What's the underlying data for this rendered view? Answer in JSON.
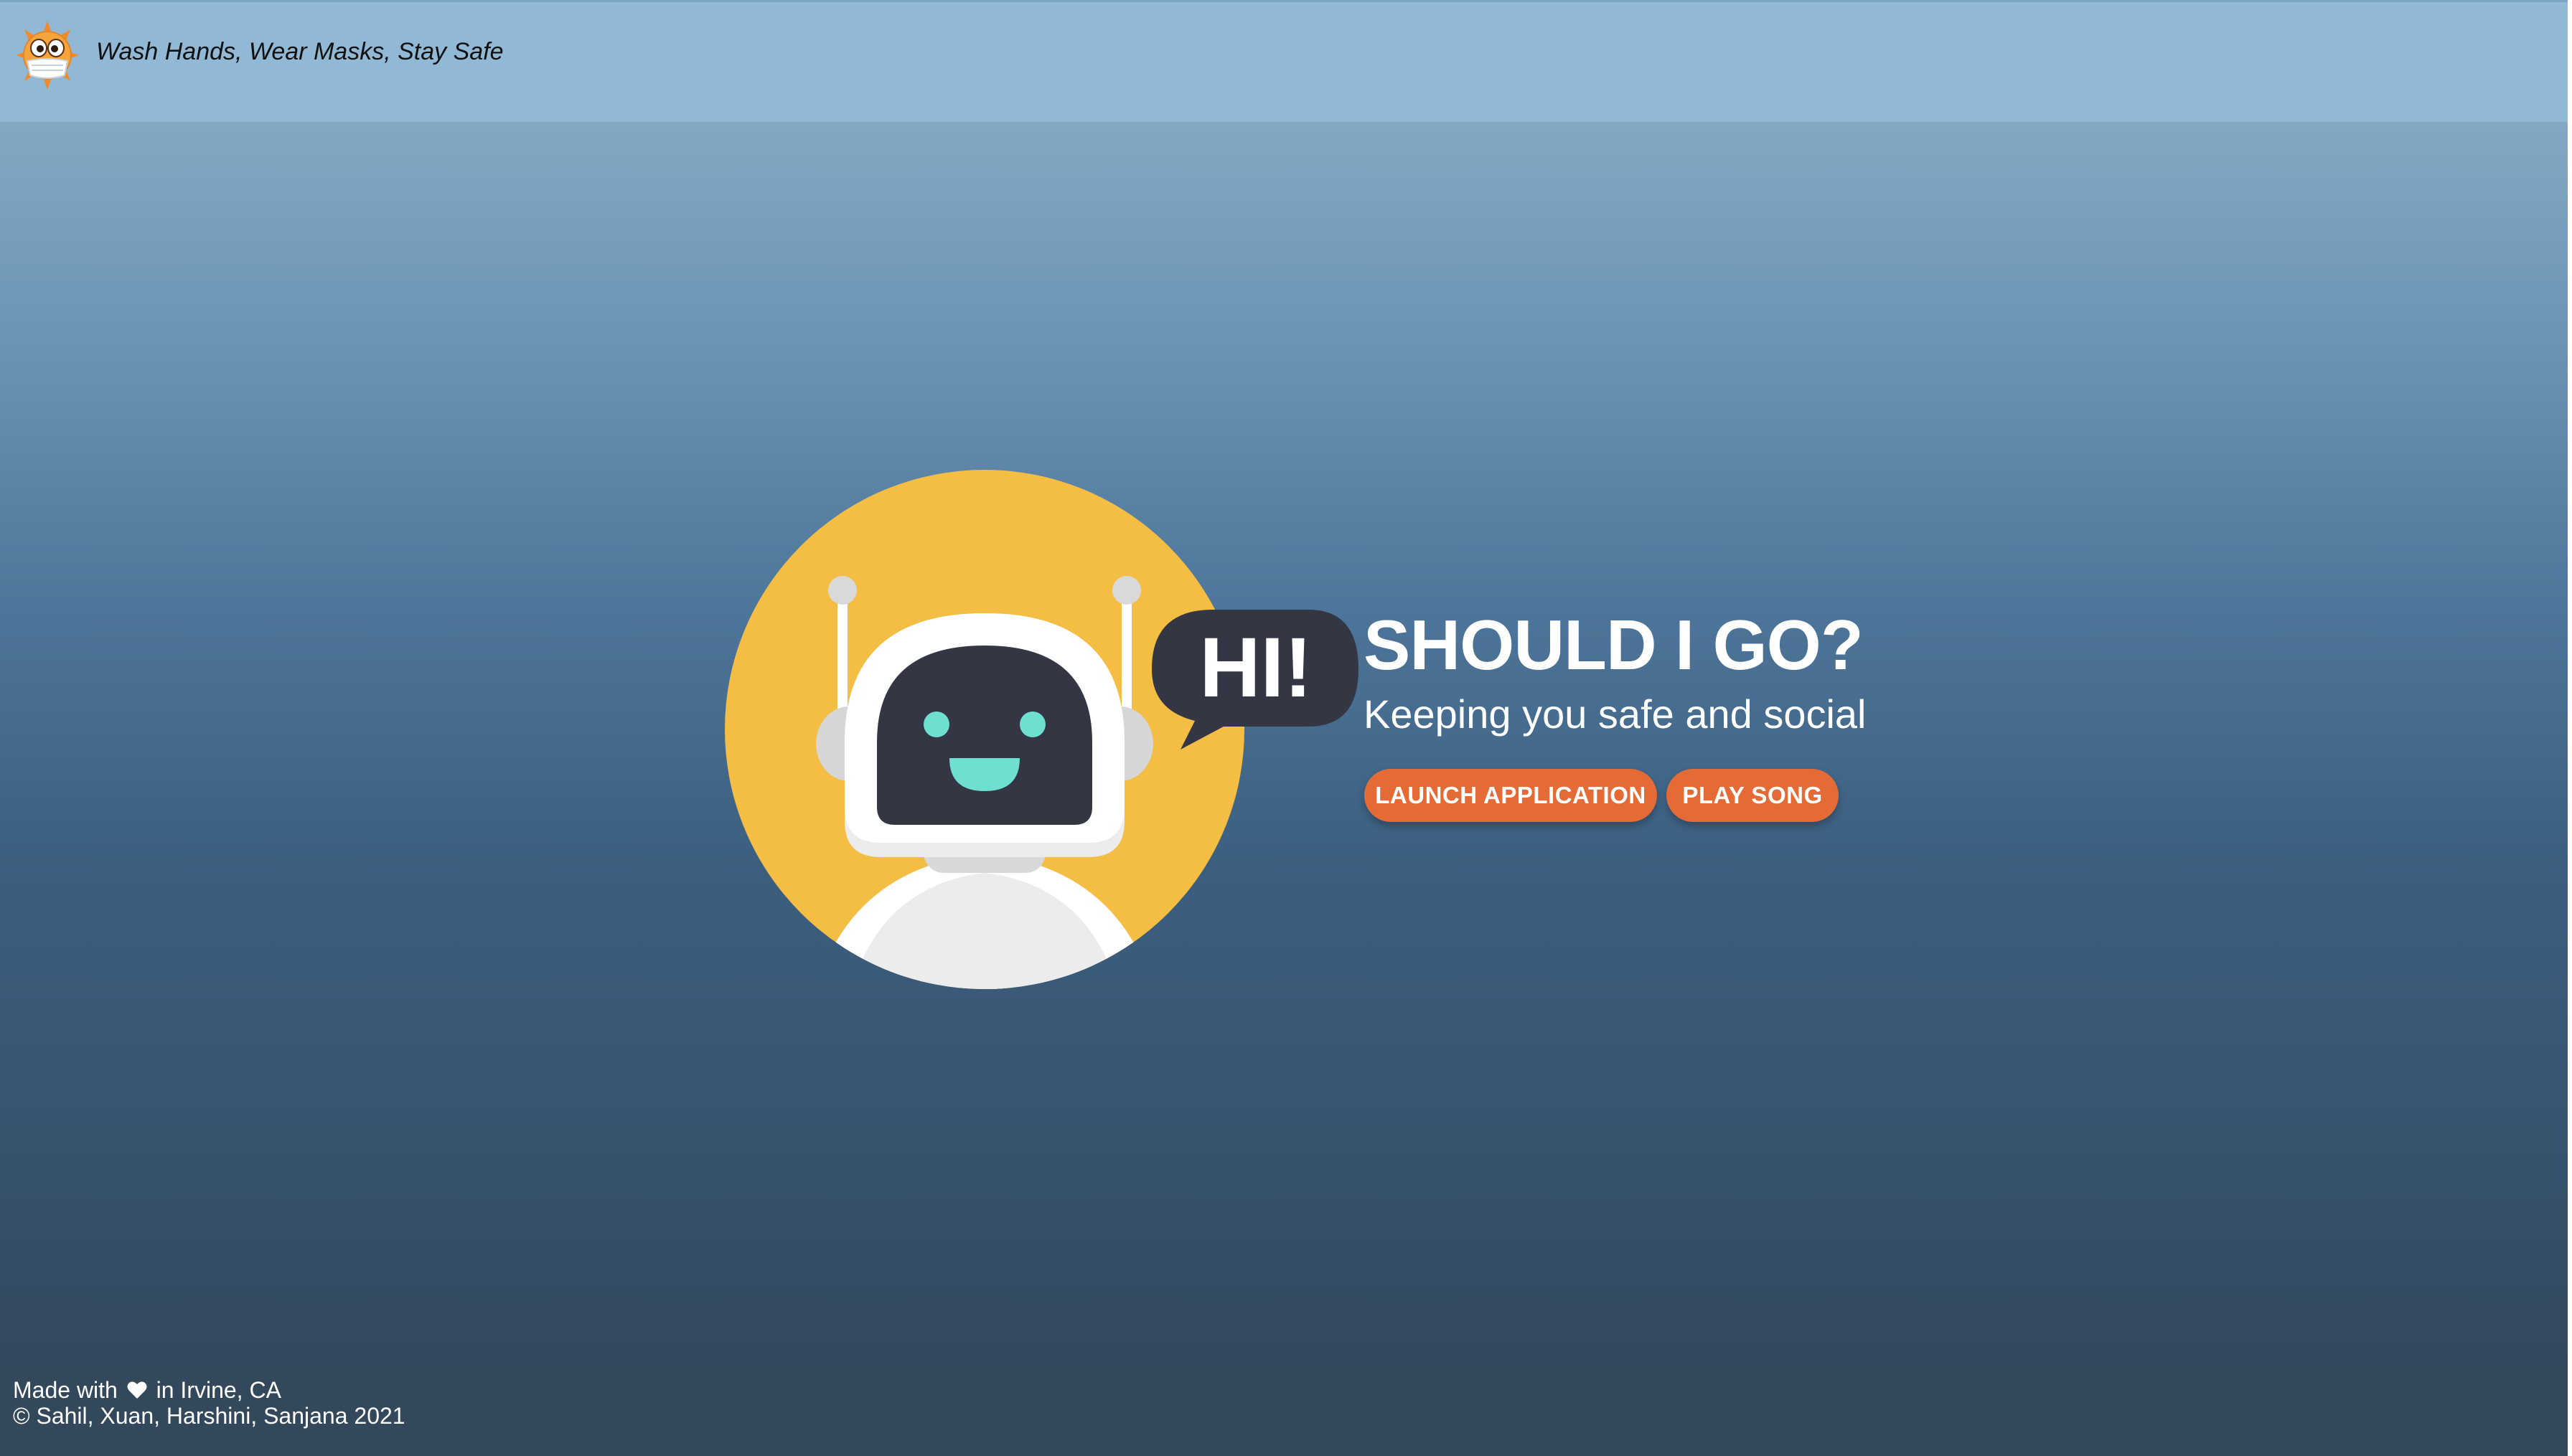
{
  "header": {
    "tagline": "Wash Hands, Wear Masks, Stay Safe",
    "logo_icon": "masked-virus-logo-icon"
  },
  "hero": {
    "illustration_icon": "robot-illustration",
    "speech_bubble_text": "HI!",
    "title": "SHOULD I GO?",
    "subtitle": "Keeping you safe and social",
    "buttons": {
      "launch_label": "LAUNCH APPLICATION",
      "song_label": "PLAY SONG"
    }
  },
  "footer": {
    "made_with_prefix": "Made with",
    "heart_icon": "heart-icon",
    "made_with_suffix": "in Irvine, CA",
    "credits": "© Sahil, Xuan, Harshini, Sanjana 2021"
  },
  "colors": {
    "header_bg": "#91b9d6",
    "accent_button": "#e46a36",
    "robot_circle": "#f4bd44",
    "robot_face": "#343743",
    "robot_eyes": "#6fe0cf",
    "footer_bg": "#34485b"
  }
}
